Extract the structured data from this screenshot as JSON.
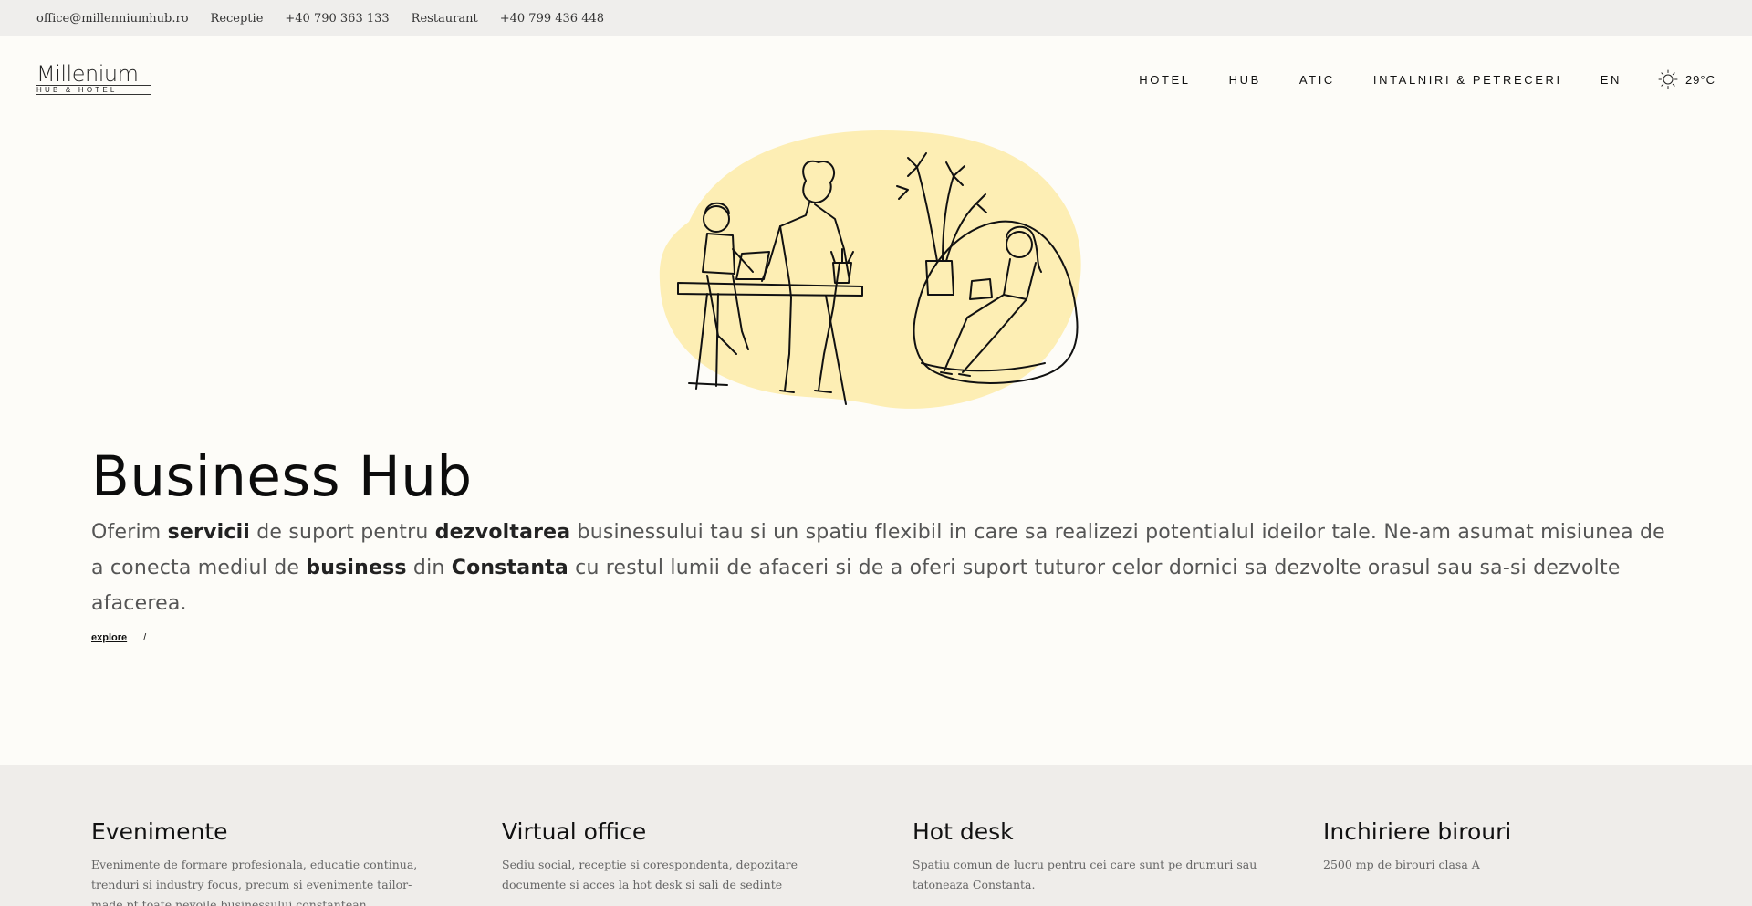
{
  "topbar": {
    "email": "office@millenniumhub.ro",
    "reception_label": "Receptie",
    "reception_phone": "+40 790 363 133",
    "restaurant_label": "Restaurant",
    "restaurant_phone": "+40 799 436 448"
  },
  "logo": {
    "main": "Millenium",
    "sub": "HUB & HOTEL"
  },
  "nav": {
    "items": [
      {
        "label": "HOTEL"
      },
      {
        "label": "HUB"
      },
      {
        "label": "ATIC"
      },
      {
        "label": "INTALNIRI & PETRECERI"
      },
      {
        "label": "EN"
      }
    ],
    "weather": "29°C",
    "weather_icon": "sun-icon"
  },
  "hero": {
    "title": "Business Hub",
    "text": [
      {
        "t": "Oferim ",
        "b": false
      },
      {
        "t": "servicii",
        "b": true
      },
      {
        "t": " de suport pentru ",
        "b": false
      },
      {
        "t": "dezvoltarea",
        "b": true
      },
      {
        "t": " businessului tau si un spatiu flexibil in care sa realizezi potentialul ideilor tale. Ne-am asumat misiunea de a conecta mediul de ",
        "b": false
      },
      {
        "t": "business",
        "b": true
      },
      {
        "t": " din ",
        "b": false
      },
      {
        "t": "Constanta",
        "b": true
      },
      {
        "t": " cu restul lumii de afaceri si de a oferi suport tuturor celor dornici sa dezvolte orasul sau sa-si dezvolte afacerea.",
        "b": false
      }
    ],
    "explore_label": "explore",
    "separator": "/"
  },
  "colors": {
    "blob": "#fdeeb4",
    "services_bg": "#efedea",
    "topbar_bg": "#efeeec"
  },
  "services": [
    {
      "title": "Evenimente",
      "text": "Evenimente de formare profesionala, educatie continua, trenduri si industry focus, precum si evenimente tailor-made pt toate nevoile businessului constantean"
    },
    {
      "title": "Virtual office",
      "text": "Sediu social, receptie si corespondenta, depozitare documente si acces la hot desk si sali de sedinte"
    },
    {
      "title": "Hot desk",
      "text": "Spatiu comun de lucru pentru cei care sunt pe drumuri sau tatoneaza Constanta."
    },
    {
      "title": "Inchiriere birouri",
      "text": "2500 mp de birouri clasa A"
    }
  ]
}
